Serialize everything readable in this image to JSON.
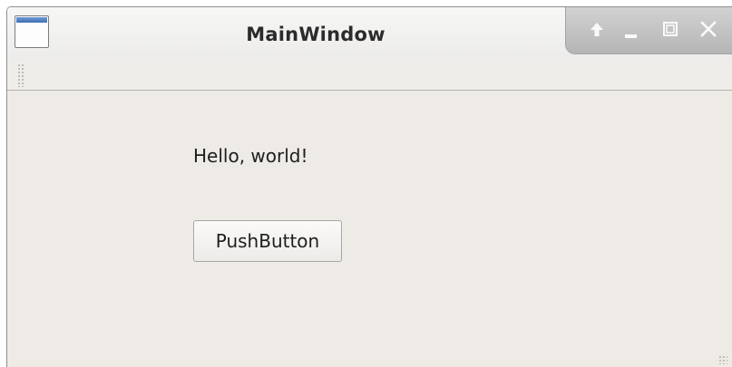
{
  "window": {
    "title": "MainWindow"
  },
  "titlebar": {
    "buttons": [
      "shade",
      "minimize",
      "maximize",
      "close"
    ]
  },
  "main": {
    "label": "Hello, world!",
    "button_label": "PushButton"
  },
  "colors": {
    "background": "#eeebe7",
    "titlebar_buttons_bg": "#c4c4c4",
    "icon_accent": "#4f7fc4"
  }
}
